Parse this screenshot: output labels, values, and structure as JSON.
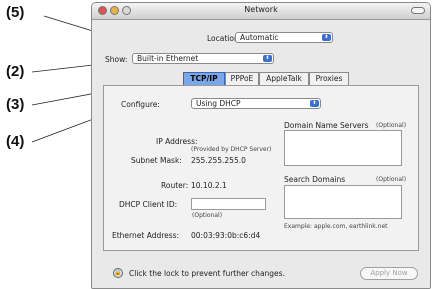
{
  "callouts": [
    "(5)",
    "(2)",
    "(3)",
    "(4)"
  ],
  "window": {
    "title": "Network"
  },
  "location": {
    "label": "Location:",
    "value": "Automatic"
  },
  "show": {
    "label": "Show:",
    "value": "Built-in Ethernet"
  },
  "tabs": [
    "TCP/IP",
    "PPPoE",
    "AppleTalk",
    "Proxies"
  ],
  "configure": {
    "label": "Configure:",
    "value": "Using DHCP"
  },
  "fields": {
    "ip_label": "IP Address:",
    "ip_note": "(Provided by DHCP Server)",
    "subnet_label": "Subnet Mask:",
    "subnet_value": "255.255.255.0",
    "router_label": "Router:",
    "router_value": "10.10.2.1",
    "dhcp_label": "DHCP Client ID:",
    "dhcp_note": "(Optional)",
    "ethernet_label": "Ethernet Address:",
    "ethernet_value": "00:03:93:0b:c6:d4"
  },
  "dns": {
    "label": "Domain Name Servers",
    "optional": "(Optional)"
  },
  "search": {
    "label": "Search Domains",
    "optional": "(Optional)",
    "example": "Example: apple.com, earthlink.net"
  },
  "footer": {
    "lock_text": "Click the lock to prevent further changes.",
    "apply_label": "Apply Now"
  }
}
